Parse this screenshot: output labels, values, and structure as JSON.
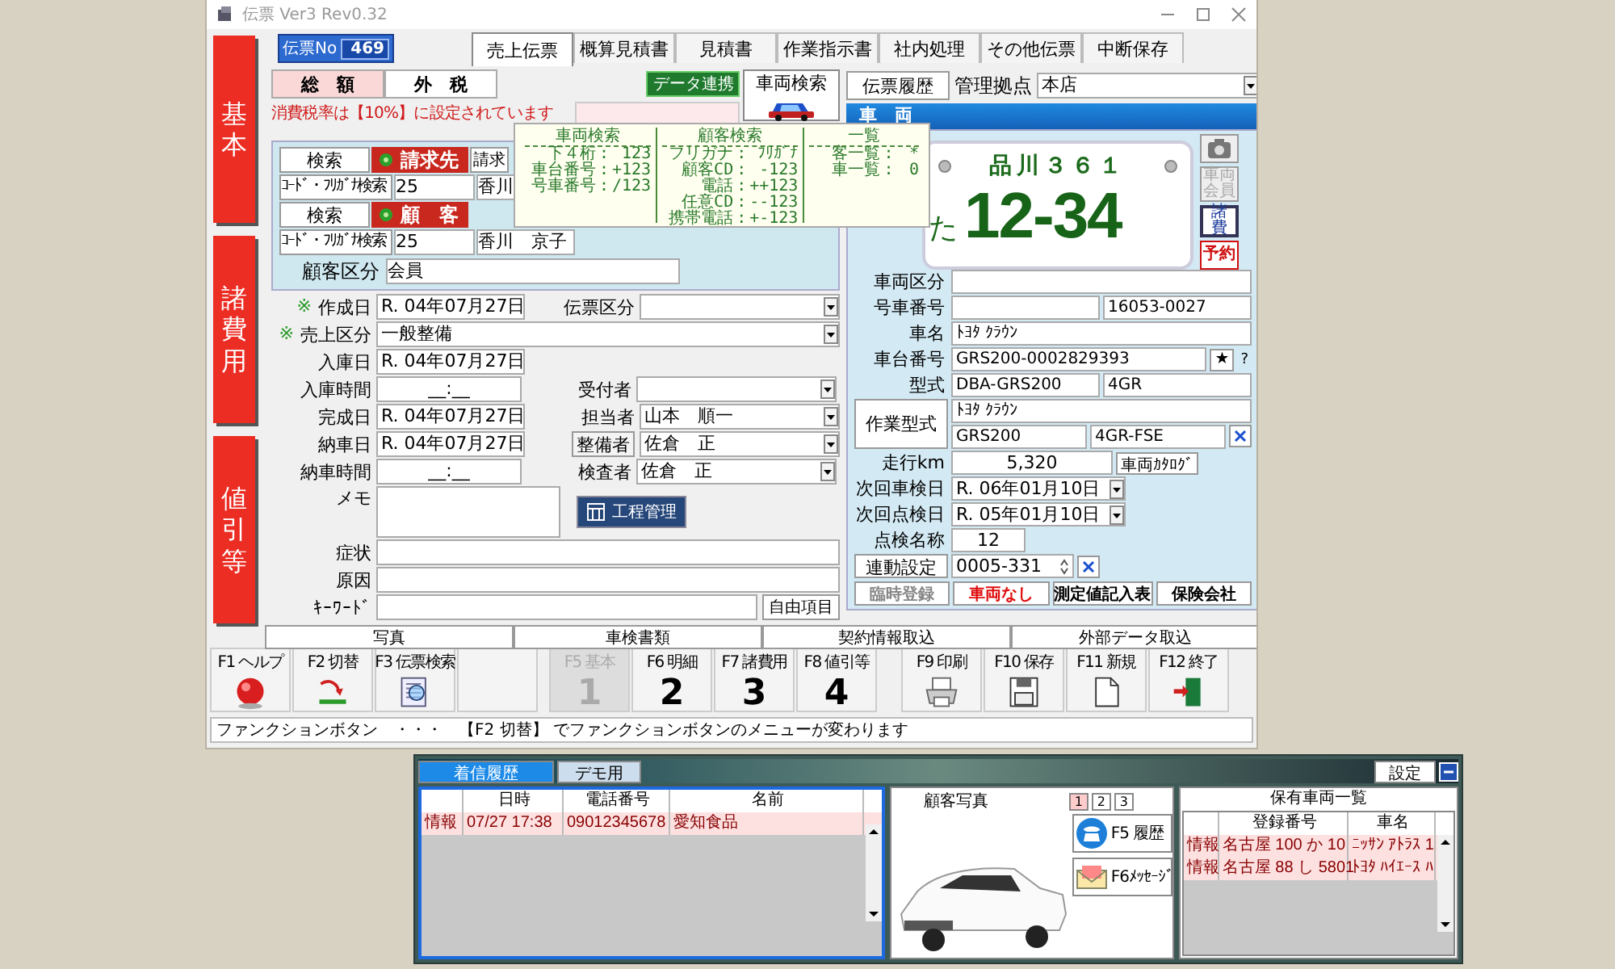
{
  "window": {
    "title": "伝票 Ver3 Rev0.32"
  },
  "side_tabs": [
    {
      "label": "基本"
    },
    {
      "label": "諸費用"
    },
    {
      "label": "値引等"
    }
  ],
  "slip_no": {
    "label": "伝票No",
    "value": "469"
  },
  "slip_tabs": [
    {
      "label": "売上伝票",
      "selected": true
    },
    {
      "label": "概算見積書",
      "selected": false
    },
    {
      "label": "見積書",
      "selected": false
    },
    {
      "label": "作業指示書",
      "selected": false
    },
    {
      "label": "社内処理",
      "selected": false
    },
    {
      "label": "その他伝票",
      "selected": false
    },
    {
      "label": "中断保存",
      "selected": false
    }
  ],
  "tax_modes": [
    {
      "label": "総　額",
      "selected": true
    },
    {
      "label": "外　税",
      "selected": false
    }
  ],
  "tax_note": "消費税率は【10%】に設定されています",
  "data_link": "データ連携",
  "vehicle_search": "車両検索",
  "slip_history": "伝票履歴",
  "base": {
    "label": "管理拠点",
    "value": "本店"
  },
  "vehicle_header": "車　両",
  "search_help": [
    {
      "title": "車両検索",
      "lines": [
        [
          "下４桁",
          ":",
          "123"
        ],
        [
          "車台番号",
          ":",
          "+123"
        ],
        [
          "号車番号",
          ":",
          "/123"
        ]
      ]
    },
    {
      "title": "顧客検索",
      "lines": [
        [
          "フリガナ",
          ":",
          "ﾌﾘｶﾞﾅ"
        ],
        [
          "顧客CD",
          ":",
          "-123"
        ],
        [
          "電話",
          ":",
          "++123"
        ],
        [
          "任意CD",
          ":",
          "--123"
        ],
        [
          "携帯電話",
          ":",
          "+-123"
        ]
      ]
    },
    {
      "title": "一覧",
      "lines": [
        [
          "客一覧",
          ":",
          "*"
        ],
        [
          "車一覧",
          ":",
          "0"
        ]
      ]
    }
  ],
  "parties": [
    {
      "search": "検索",
      "title": "請求先",
      "extra_button": "請求",
      "kana_label": "ｺｰﾄﾞ・ﾌﾘｶﾞﾅ検索",
      "code": "25",
      "name": "香川"
    },
    {
      "search": "検索",
      "title": "顧　客",
      "kana_label": "ｺｰﾄﾞ・ﾌﾘｶﾞﾅ検索",
      "code": "25",
      "name": "香川　京子"
    }
  ],
  "customer_class": {
    "label": "顧客区分",
    "value": "会員"
  },
  "form_rows": [
    [
      {
        "mark": "※",
        "label": "作成日",
        "kind": "date",
        "value": "R. 04年07月27日"
      },
      {
        "label": "伝票区分",
        "kind": "select"
      }
    ],
    [
      {
        "mark": "※",
        "label": "売上区分",
        "kind": "select",
        "value": "一般整備"
      }
    ],
    [
      {
        "label": "入庫日",
        "kind": "date",
        "value": "R. 04年07月27日"
      }
    ],
    [
      {
        "label": "入庫時間",
        "kind": "time",
        "value": "__:__"
      },
      {
        "label": "受付者",
        "kind": "select"
      }
    ],
    [
      {
        "label": "完成日",
        "kind": "date",
        "value": "R. 04年07月27日"
      },
      {
        "label": "担当者",
        "kind": "select",
        "value": "山本　順一"
      }
    ],
    [
      {
        "label": "納車日",
        "kind": "date",
        "value": "R. 04年07月27日"
      },
      {
        "label": "整備者",
        "as_button": true,
        "kind": "select",
        "value": "佐倉　正"
      }
    ],
    [
      {
        "label": "納車時間",
        "kind": "time",
        "value": "__:__"
      },
      {
        "label": "検査者",
        "kind": "select",
        "value": "佐倉　正"
      }
    ],
    [
      {
        "label": "メモ",
        "kind": "memo"
      },
      {
        "label": "工程管理",
        "kind": "button"
      }
    ],
    [
      {
        "label": "症状",
        "kind": "text"
      }
    ],
    [
      {
        "label": "原因",
        "kind": "text"
      }
    ],
    [
      {
        "label": "ｷｰﾜｰﾄﾞ",
        "kind": "text"
      },
      {
        "label": "自由項目",
        "kind": "button"
      }
    ]
  ],
  "plate": {
    "region": "品川３６１",
    "kana": "た",
    "number": "12-34"
  },
  "vehicle_side_buttons": [
    {
      "kind": "photo"
    },
    {
      "kind": "member",
      "label": "車両会員",
      "disabled": true
    },
    {
      "kind": "misc",
      "label": "諸費"
    },
    {
      "kind": "reserve",
      "label": "予約"
    }
  ],
  "vehicle_rows": [
    {
      "label": "車両区分",
      "cells": [
        {
          "kind": "text"
        }
      ]
    },
    {
      "label": "号車番号",
      "cells": [
        {
          "kind": "text"
        },
        {
          "kind": "text",
          "value": "16053-0027"
        }
      ]
    },
    {
      "label": "車名",
      "cells": [
        {
          "kind": "text",
          "value": "ﾄﾖﾀ ｸﾗｳﾝ"
        }
      ]
    },
    {
      "label": "車台番号",
      "cells": [
        {
          "kind": "text",
          "value": "GRS200-0002829393"
        },
        {
          "kind": "button",
          "value": "★"
        },
        {
          "kind": "note",
          "value": "?"
        }
      ]
    },
    {
      "label": "型式",
      "cells": [
        {
          "kind": "text",
          "value": "DBA-GRS200"
        },
        {
          "kind": "text",
          "value": "4GR"
        }
      ]
    },
    {
      "label": "作業型式",
      "as_button": true,
      "lines": [
        [
          {
            "kind": "text",
            "value": "ﾄﾖﾀ ｸﾗｳﾝ"
          }
        ],
        [
          {
            "kind": "text",
            "value": "GRS200"
          },
          {
            "kind": "text",
            "value": "4GR-FSE"
          },
          {
            "kind": "clear"
          }
        ]
      ]
    },
    {
      "label": "走行km",
      "cells": [
        {
          "kind": "number",
          "value": "5,320"
        },
        {
          "kind": "button",
          "value": "車両ｶﾀﾛｸﾞ"
        }
      ]
    },
    {
      "label": "次回車検日",
      "cells": [
        {
          "kind": "date",
          "value": "R. 06年01月10日"
        }
      ]
    },
    {
      "label": "次回点検日",
      "cells": [
        {
          "kind": "date",
          "value": "R. 05年01月10日"
        }
      ]
    },
    {
      "label": "点検名称",
      "cells": [
        {
          "kind": "number",
          "value": "12"
        }
      ]
    },
    {
      "label": "連動設定",
      "as_button": true,
      "cells": [
        {
          "kind": "spin",
          "value": "0005-331"
        },
        {
          "kind": "clear"
        }
      ]
    }
  ],
  "vehicle_actions": [
    {
      "label": "臨時登録",
      "color": "#888888"
    },
    {
      "label": "車両なし",
      "color": "#e01010"
    },
    {
      "label": "測定値記入表",
      "color": "#000000"
    },
    {
      "label": "保険会社",
      "color": "#000000"
    }
  ],
  "section_tabs": [
    "写真",
    "車検書類",
    "契約情報取込",
    "外部データ取込"
  ],
  "function_keys": [
    {
      "label": "F1 ヘルプ",
      "kind": "help",
      "disabled": false
    },
    {
      "label": "F2 切替",
      "kind": "swap",
      "disabled": false
    },
    {
      "label": "F3 伝票検索",
      "kind": "search",
      "disabled": false
    },
    {
      "kind": "empty",
      "disabled": false
    },
    {
      "label": "F5 基本",
      "kind": "digit",
      "digit": "1",
      "disabled": true
    },
    {
      "label": "F6 明細",
      "kind": "digit",
      "digit": "2",
      "disabled": false
    },
    {
      "label": "F7 諸費用",
      "kind": "digit",
      "digit": "3",
      "disabled": false
    },
    {
      "label": "F8 値引等",
      "kind": "digit",
      "digit": "4",
      "disabled": false
    },
    {
      "label": "F9 印刷",
      "kind": "print",
      "disabled": false
    },
    {
      "label": "F10 保存",
      "kind": "save",
      "disabled": false
    },
    {
      "label": "F11 新規",
      "kind": "new",
      "disabled": false
    },
    {
      "label": "F12 終了",
      "kind": "exit",
      "disabled": false
    }
  ],
  "status_text": "ファンクションボタン　・・・　【F2 切替】 でファンクションボタンのメニューが変わります",
  "phone_panel": {
    "tabs": [
      {
        "label": "着信履歴",
        "selected": true
      },
      {
        "label": "デモ用",
        "selected": false
      }
    ],
    "settings": "設定",
    "calls": {
      "columns": [
        "日時",
        "電話番号",
        "名前"
      ],
      "rows": [
        {
          "type": "情報",
          "time": "07/27 17:38",
          "phone": "09012345678",
          "name": "愛知食品"
        }
      ]
    },
    "photo_title": "顧客写真",
    "photo_pages": [
      {
        "label": "1",
        "selected": true
      },
      {
        "label": "2",
        "selected": false
      },
      {
        "label": "3",
        "selected": false
      }
    ],
    "history_button": "F5 履歴",
    "message_button": "F6ﾒｯｾｰｼﾞ",
    "vehicles": {
      "title": "保有車両一覧",
      "columns": [
        "登録番号",
        "車名"
      ],
      "rows": [
        {
          "type": "情報",
          "plate": "名古屋 100 か 10",
          "name": "ﾆｯｻﾝ ｱﾄﾗｽ 1"
        },
        {
          "type": "情報",
          "plate": "名古屋 88 し 5801",
          "name": "ﾄﾖﾀ ﾊｲｴｰｽ ﾊ"
        }
      ]
    }
  }
}
